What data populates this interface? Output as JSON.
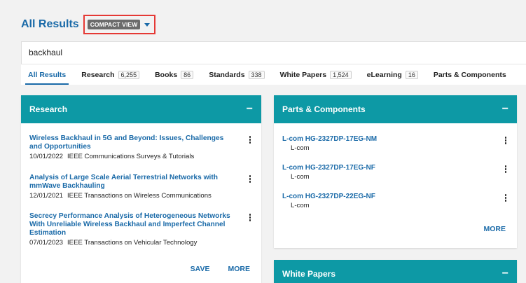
{
  "header": {
    "title": "All Results",
    "view_label": "COMPACT VIEW"
  },
  "search": {
    "value": "backhaul"
  },
  "tabs": [
    {
      "label": "All Results",
      "count": ""
    },
    {
      "label": "Research",
      "count": "6,255"
    },
    {
      "label": "Books",
      "count": "86"
    },
    {
      "label": "Standards",
      "count": "338"
    },
    {
      "label": "White Papers",
      "count": "1,524"
    },
    {
      "label": "eLearning",
      "count": "16"
    },
    {
      "label": "Parts & Components",
      "count": ""
    }
  ],
  "research": {
    "title": "Research",
    "collapse": "−",
    "items": [
      {
        "title": "Wireless Backhaul in 5G and Beyond: Issues, Challenges and Opportunities",
        "date": "10/01/2022",
        "source": "IEEE Communications Surveys & Tutorials"
      },
      {
        "title": "Analysis of Large Scale Aerial Terrestrial Networks with mmWave Backhauling",
        "date": "12/01/2021",
        "source": "IEEE Transactions on Wireless Communications"
      },
      {
        "title": "Secrecy Performance Analysis of Heterogeneous Networks With Unreliable Wireless Backhaul and Imperfect Channel Estimation",
        "date": "07/01/2023",
        "source": "IEEE Transactions on Vehicular Technology"
      }
    ],
    "save_label": "SAVE",
    "more_label": "MORE"
  },
  "parts": {
    "title": "Parts & Components",
    "collapse": "−",
    "items": [
      {
        "title": "L-com HG-2327DP-17EG-NM",
        "vendor": "L-com"
      },
      {
        "title": "L-com HG-2327DP-17EG-NF",
        "vendor": "L-com"
      },
      {
        "title": "L-com HG-2327DP-22EG-NF",
        "vendor": "L-com"
      }
    ],
    "more_label": "MORE"
  },
  "whitepapers": {
    "title": "White Papers",
    "collapse": "−"
  }
}
